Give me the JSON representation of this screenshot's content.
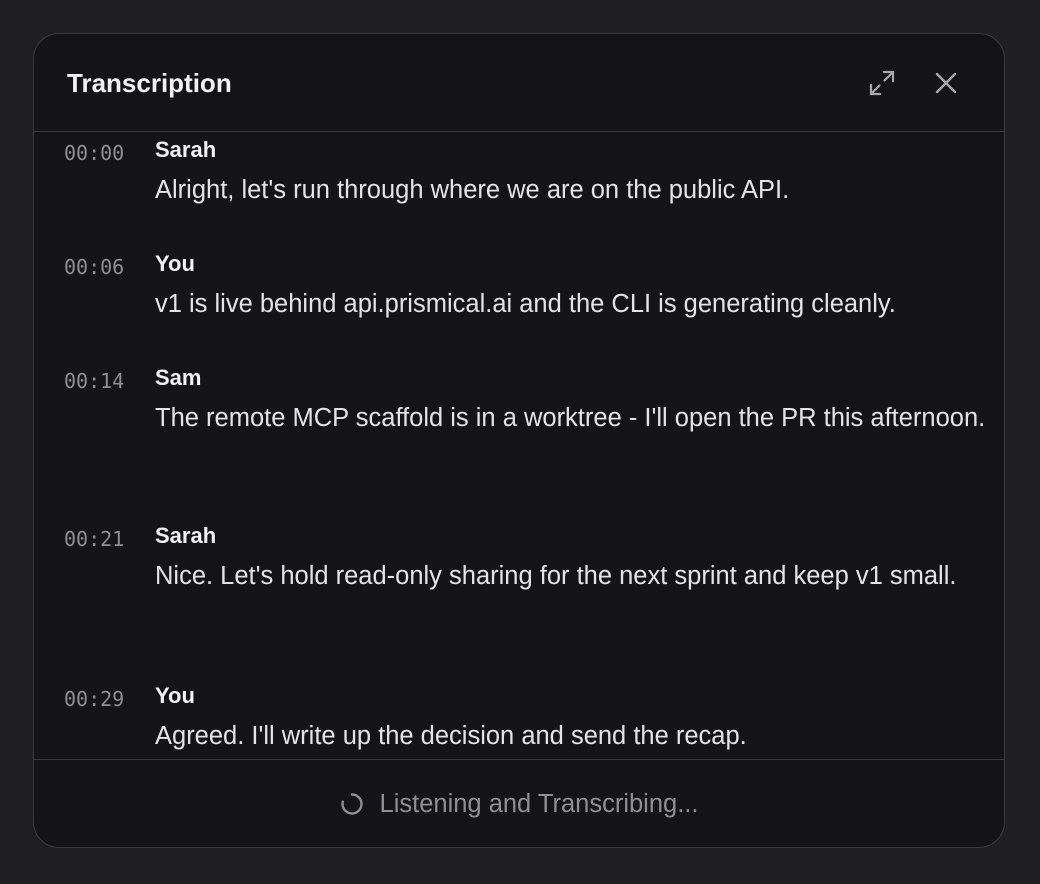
{
  "header": {
    "title": "Transcription",
    "expand_icon": "expand-icon",
    "close_icon": "close-icon"
  },
  "transcript": [
    {
      "time": "00:00",
      "speaker": "Sarah",
      "text": "Alright, let's run through where we are on the public API."
    },
    {
      "time": "00:06",
      "speaker": "You",
      "text": "v1 is live behind api.prismical.ai and the CLI is generating cleanly."
    },
    {
      "time": "00:14",
      "speaker": "Sam",
      "text": "The remote MCP scaffold is in a worktree - I'll open the PR this afternoon."
    },
    {
      "time": "00:21",
      "speaker": "Sarah",
      "text": "Nice. Let's hold read-only sharing for the next sprint and keep v1 small."
    },
    {
      "time": "00:29",
      "speaker": "You",
      "text": "Agreed. I'll write up the decision and send the recap."
    }
  ],
  "footer": {
    "status_text": "Listening and Transcribing...",
    "status_icon": "spinner-icon"
  },
  "colors": {
    "background": "#1f1f22",
    "panel": "#141416",
    "border": "#3a3a3e",
    "text_primary": "#f2f2f3",
    "text_muted": "#8e8e94"
  }
}
